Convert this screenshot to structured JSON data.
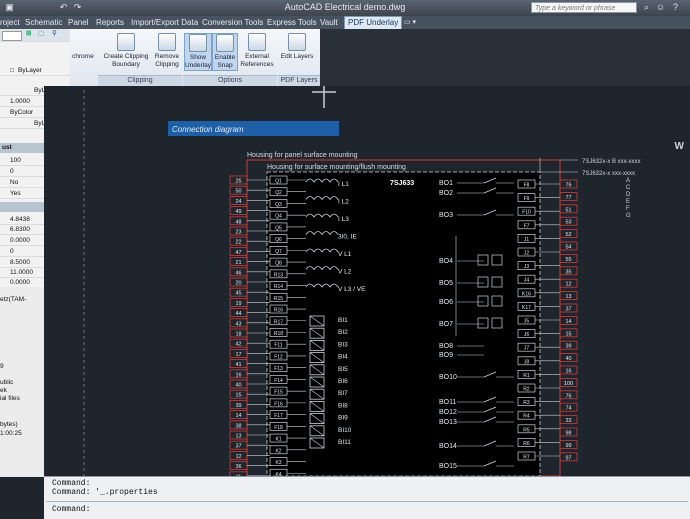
{
  "titlebar": {
    "title": "AutoCAD Electrical   demo.dwg",
    "search_placeholder": "Type a keyword or phrase"
  },
  "tabs": [
    "roject",
    "Schematic",
    "Panel",
    "Reports",
    "Import/Export Data",
    "Conversion Tools",
    "Express Tools",
    "Vault",
    "PDF Underlay"
  ],
  "ribbon": {
    "partial_label": "chrome",
    "clipping": {
      "title": "Clipping",
      "buttons": [
        "Create Clipping Boundary",
        "Remove Clipping"
      ]
    },
    "options": {
      "title": "Options",
      "buttons": [
        "Show Underlay",
        "Enable Snap",
        "External References"
      ]
    },
    "pdf_layers": {
      "title": "PDF Layers",
      "buttons": [
        "Edit Layers"
      ]
    }
  },
  "properties": {
    "rows_top": [
      "ByLayer",
      "ByLayer",
      "1.0000",
      "ByColor",
      "ByLayer"
    ],
    "section_2": "ust",
    "rows_mid": [
      "100",
      "0",
      "No",
      "Yes"
    ],
    "rows_geom": [
      "4.8438",
      "6.8300",
      "0.0000",
      "0",
      "8.5000",
      "11.0000",
      "0.0000"
    ]
  },
  "left_lower": [
    "etz(TAM-",
    "9",
    "ublic",
    "ek",
    "ial files",
    "bytes)",
    "1:00:25"
  ],
  "drawing": {
    "heading": "Connection diagram",
    "housing_panel": "Housing for panel surface mounting",
    "housing_flush": "Housing for surface mounting/flush mounting",
    "device": "7SJ633",
    "ref_right_1": "7SJ632x-x  B  xxx-xxxx",
    "ref_right_2": "7SJ632x-x  xxx-xxxx",
    "letters_right": [
      "A",
      "C",
      "D",
      "E",
      "F",
      "G"
    ],
    "corner_letter": "W",
    "left_terms": [
      "25",
      "50",
      "24",
      "49",
      "48",
      "23",
      "22",
      "47",
      "21",
      "46",
      "20",
      "45",
      "19",
      "44",
      "43",
      "18",
      "42",
      "17",
      "41",
      "16",
      "40",
      "15",
      "39",
      "14",
      "38",
      "13",
      "37",
      "12",
      "36",
      "11",
      "35"
    ],
    "inner_terms": [
      "Q1",
      "Q2",
      "Q3",
      "Q4",
      "Q5",
      "Q6",
      "Q7",
      "Q8",
      "R13",
      "R14",
      "R15",
      "R16",
      "R17",
      "R18",
      "F11",
      "F12",
      "F13",
      "F14",
      "F15",
      "F16",
      "F17",
      "F18",
      "K1",
      "K2",
      "K3",
      "K4",
      "K5"
    ],
    "mid_labels": [
      "I L1",
      "I L2",
      "I L3",
      "3I0, IE",
      "V L1",
      "V L2",
      "V L3 / VE",
      "BI1",
      "BI2",
      "BI3",
      "BI4",
      "BI5",
      "BI6",
      "BI7",
      "BI8",
      "BI9",
      "BI10",
      "BI11"
    ],
    "right_bo": [
      "BO1",
      "BO2",
      "BO3",
      "BO4",
      "BO5",
      "BO6",
      "BO7",
      "BO8",
      "BO9",
      "BO10",
      "BO11",
      "BO12",
      "BO13",
      "BO14",
      "BO15"
    ],
    "right_inner_terms": [
      "F8",
      "F9",
      "F10",
      "F7",
      "J1",
      "J2",
      "J3",
      "J4",
      "K16",
      "K17",
      "J5",
      "J6",
      "J7",
      "J8",
      "R1",
      "R2",
      "R3",
      "R4",
      "R5",
      "R6",
      "R7"
    ],
    "right_outer_terms": [
      "76",
      "77",
      "51",
      "53",
      "52",
      "54",
      "55",
      "35",
      "12",
      "13",
      "37",
      "14",
      "15",
      "39",
      "40",
      "16",
      "100",
      "76",
      "74",
      "33",
      "98",
      "99",
      "97"
    ]
  },
  "command": {
    "line1": "Command:",
    "line2": "Command: '_.properties",
    "prompt": "Command:"
  }
}
